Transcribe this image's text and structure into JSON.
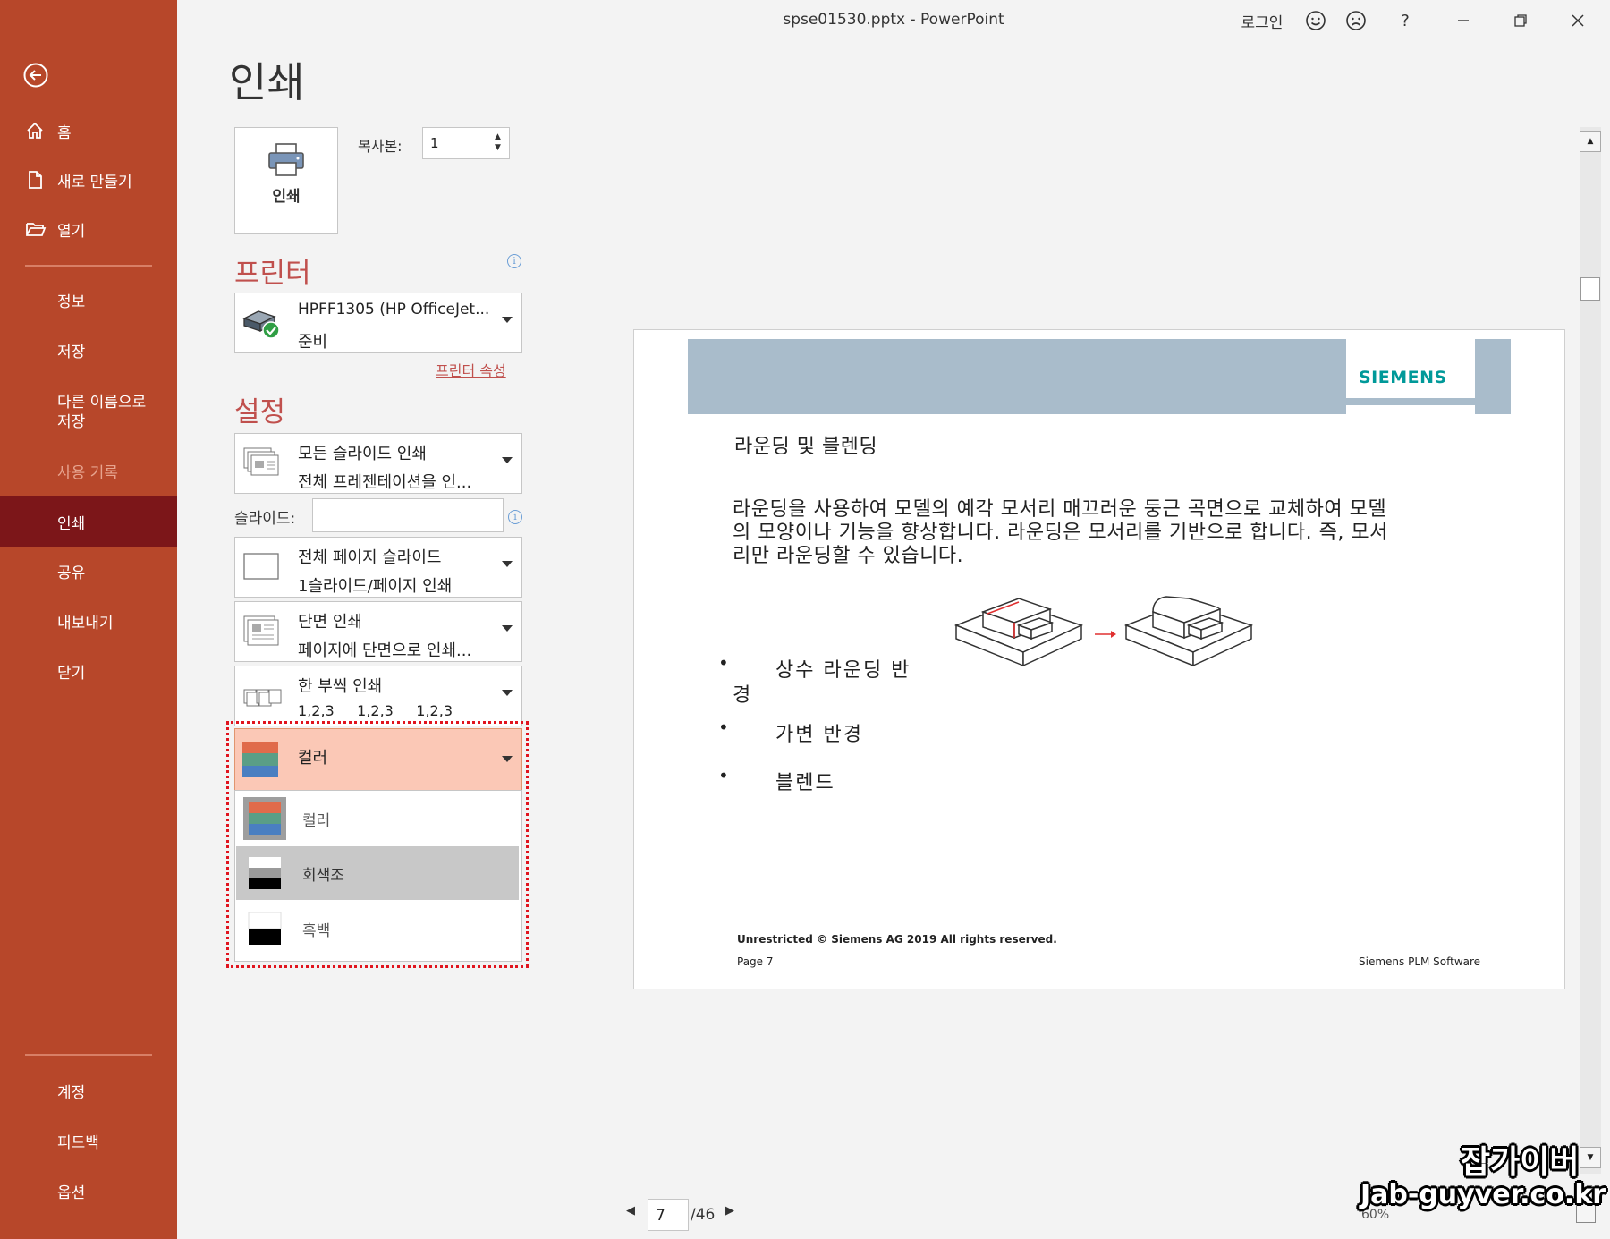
{
  "window": {
    "title": "spse01530.pptx  -  PowerPoint",
    "login": "로그인"
  },
  "sidebar": {
    "items": [
      {
        "label": "홈",
        "icon": "home-icon"
      },
      {
        "label": "새로 만들기",
        "icon": "new-document-icon"
      },
      {
        "label": "열기",
        "icon": "open-folder-icon"
      },
      {
        "label": "정보"
      },
      {
        "label": "저장"
      },
      {
        "label": "다른 이름으로\n저장"
      },
      {
        "label": "사용 기록"
      },
      {
        "label": "인쇄"
      },
      {
        "label": "공유"
      },
      {
        "label": "내보내기"
      },
      {
        "label": "닫기"
      },
      {
        "label": "계정"
      },
      {
        "label": "피드백"
      },
      {
        "label": "옵션"
      }
    ]
  },
  "print": {
    "heading": "인쇄",
    "print_button": "인쇄",
    "copies_label": "복사본:",
    "copies_value": "1",
    "printer_heading": "프린터",
    "printer_name": "HPFF1305 (HP OfficeJet...",
    "printer_status": "준비",
    "printer_props": "프린터 속성",
    "settings_heading": "설정",
    "slides_range_l1": "모든 슬라이드 인쇄",
    "slides_range_l2": "전체 프레젠테이션을 인...",
    "slides_label": "슬라이드:",
    "slides_value": "",
    "layout_l1": "전체 페이지 슬라이드",
    "layout_l2": "1슬라이드/페이지 인쇄",
    "sides_l1": "단면 인쇄",
    "sides_l2": "페이지에 단면으로 인쇄...",
    "collate_l1": "한 부씩 인쇄",
    "collate_l2": "1,2,3     1,2,3     1,2,3",
    "color_selected": "컬러",
    "color_options": [
      "컬러",
      "회색조",
      "흑백"
    ]
  },
  "slide": {
    "brand": "SIEMENS",
    "title": "라운딩 및 블렌딩",
    "body_line1": "라운딩을 사용하여 모델의 예각 모서리 매끄러운 둥근 곡면으로 교체하여 모델",
    "body_line2": "의 모양이나 기능을 향상합니다. 라운딩은 모서리를 기반으로 합니다. 즉, 모서",
    "body_line3": "리만 라운딩할 수 있습니다.",
    "bullet1a": "상수 라운딩 반",
    "bullet1b": "경",
    "bullet2": "가변 반경",
    "bullet3": "블렌드",
    "footer_left": "Unrestricted © Siemens AG 2019 All rights reserved.",
    "footer_page": "Page 7",
    "footer_right": "Siemens PLM Software"
  },
  "pager": {
    "current": "7",
    "total": "/46",
    "zoom": "60%"
  },
  "watermark": {
    "line1": "잡가이버",
    "line2": "Jab-guyver.co.kr"
  },
  "colors": {
    "sidebar": "#b7472a",
    "active": "#7c1619",
    "accent": "#c0504d",
    "highlight": "#fbc8b6",
    "siemens": "#009999"
  }
}
